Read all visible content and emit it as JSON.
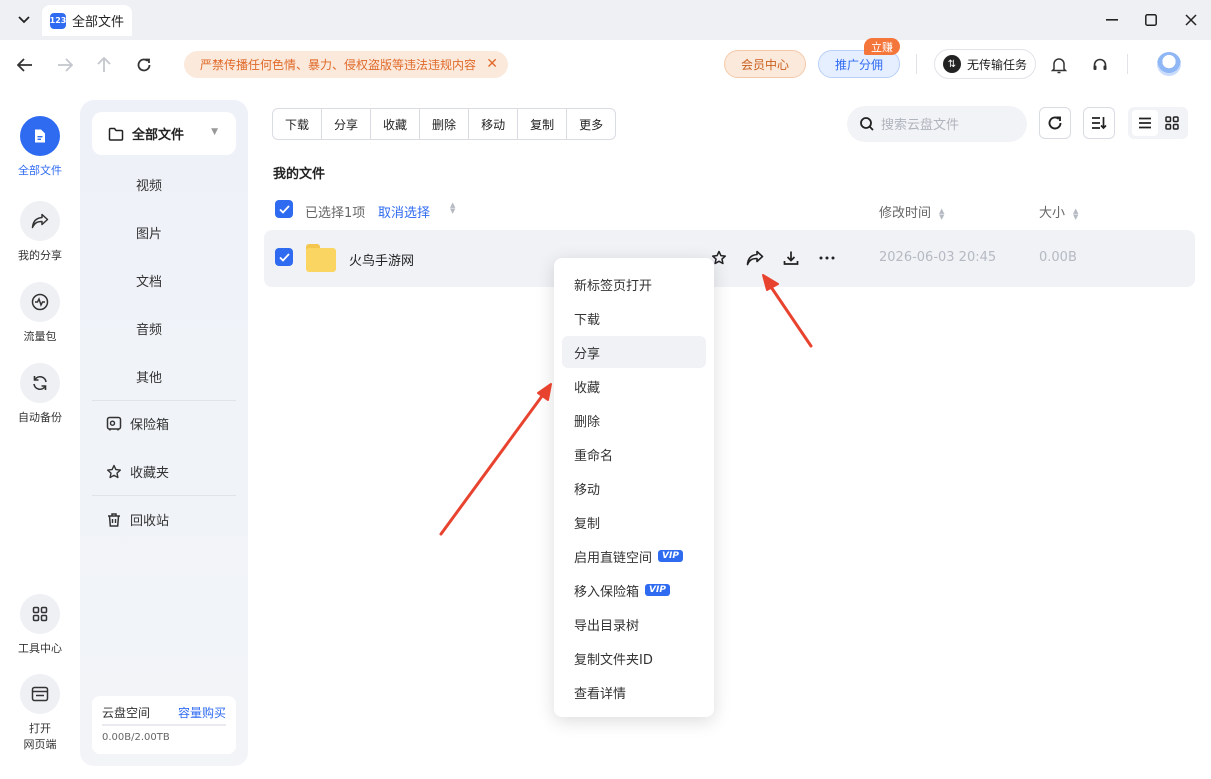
{
  "window": {
    "tab_title": "全部文件",
    "tab_logo": "123"
  },
  "toolbar": {
    "notice": "严禁传播任何色情、暴力、侵权盗版等违法违规内容",
    "vip_center": "会员中心",
    "promo": "推广分佣",
    "promo_badge": "立赚",
    "transfer": "无传输任务"
  },
  "rail": {
    "items": [
      {
        "label": "全部文件",
        "icon": "folder-icon"
      },
      {
        "label": "我的分享",
        "icon": "share-icon"
      },
      {
        "label": "流量包",
        "icon": "traffic-icon"
      },
      {
        "label": "自动备份",
        "icon": "sync-icon"
      },
      {
        "label": "工具中心",
        "icon": "grid-icon"
      },
      {
        "label_line1": "打开",
        "label_line2": "网页端",
        "icon": "browser-icon"
      }
    ]
  },
  "sidebar": {
    "head": "全部文件",
    "subs": [
      "视频",
      "图片",
      "文档",
      "音频",
      "其他"
    ],
    "vault": "保险箱",
    "favorites": "收藏夹",
    "recycle": "回收站",
    "storage_label": "云盘空间",
    "storage_buy": "容量购买",
    "storage_used": "0.00B/2.00TB"
  },
  "actions": [
    "下载",
    "分享",
    "收藏",
    "删除",
    "移动",
    "复制",
    "更多"
  ],
  "search": {
    "placeholder": "搜索云盘文件"
  },
  "breadcrumb": "我的文件",
  "list_header": {
    "selected": "已选择1项",
    "cancel": "取消选择",
    "mtime": "修改时间",
    "size": "大小"
  },
  "file": {
    "name": "火鸟手游网",
    "mtime": "2026-06-03 20:45",
    "size": "0.00B"
  },
  "context_menu": [
    {
      "label": "新标签页打开"
    },
    {
      "label": "下载"
    },
    {
      "label": "分享",
      "hover": true
    },
    {
      "label": "收藏"
    },
    {
      "label": "删除"
    },
    {
      "label": "重命名"
    },
    {
      "label": "移动"
    },
    {
      "label": "复制"
    },
    {
      "label": "启用直链空间",
      "badge": "VIP"
    },
    {
      "label": "移入保险箱",
      "badge": "VIP"
    },
    {
      "label": "导出目录树"
    },
    {
      "label": "复制文件夹ID"
    },
    {
      "label": "查看详情"
    }
  ],
  "colors": {
    "accent": "#2f6bf0",
    "annotation_arrow": "#e8432f",
    "notice": "#e06a2a"
  }
}
